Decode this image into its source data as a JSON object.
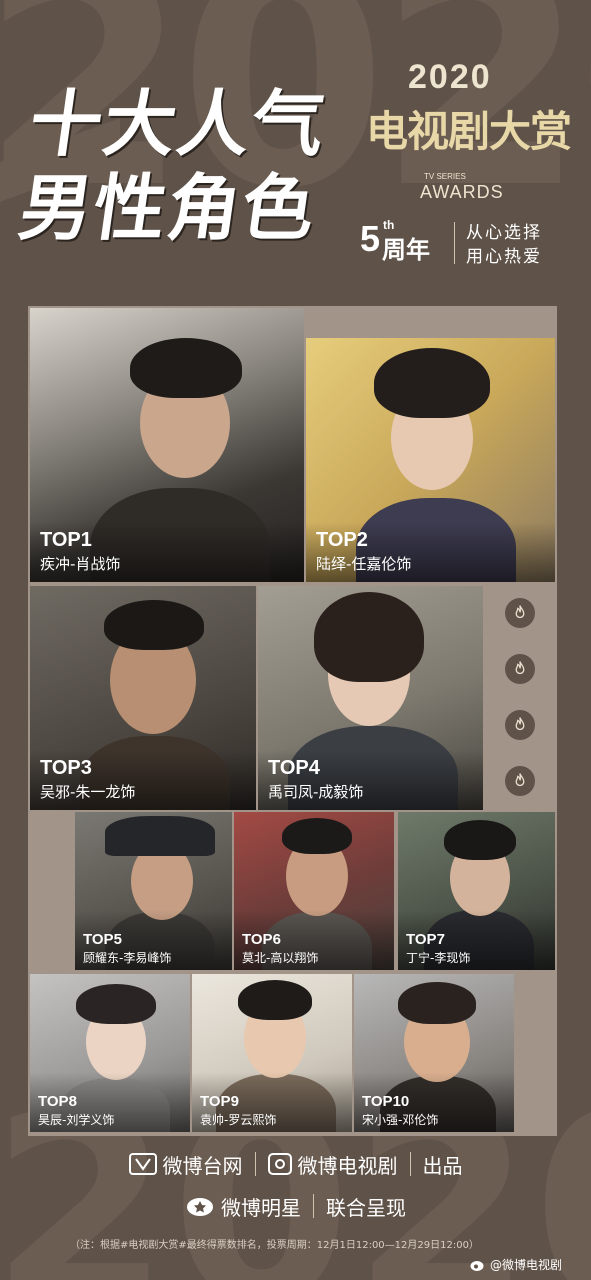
{
  "background": {
    "numerals": "2020"
  },
  "header": {
    "headline_line1": "十大人气",
    "headline_line2": "男性角色",
    "year": "2020",
    "award_name": "电视剧大赏",
    "tv_series": "TV SERIES",
    "awards": "AWARDS",
    "anniversary_number": "5",
    "anniversary_suffix": "th",
    "anniversary_word": "周年",
    "slogan_line1": "从心选择",
    "slogan_line2": "用心热爱"
  },
  "ranking": [
    {
      "rank": "TOP1",
      "role": "疾冲-肖战饰"
    },
    {
      "rank": "TOP2",
      "role": "陆绎-任嘉伦饰"
    },
    {
      "rank": "TOP3",
      "role": "吴邪-朱一龙饰"
    },
    {
      "rank": "TOP4",
      "role": "禹司凤-成毅饰"
    },
    {
      "rank": "TOP5",
      "role": "顾耀东-李易峰饰"
    },
    {
      "rank": "TOP6",
      "role": "莫北-高以翔饰"
    },
    {
      "rank": "TOP7",
      "role": "丁宁-李现饰"
    },
    {
      "rank": "TOP8",
      "role": "昊辰-刘学义饰"
    },
    {
      "rank": "TOP9",
      "role": "袁帅-罗云熙饰"
    },
    {
      "rank": "TOP10",
      "role": "宋小强-邓伦饰"
    }
  ],
  "decor": {
    "fire_icon_count": 4
  },
  "footer": {
    "logo1": "微博台网",
    "logo2": "微博电视剧",
    "produced": "出品",
    "logo3": "微博明星",
    "joint": "联合呈现",
    "note": "（注：根据#电视剧大赏#最终得票数排名，投票周期：12月1日12:00—12月29日12:00）",
    "watermark": "@微博电视剧"
  },
  "colors": {
    "background": "#5f5248",
    "frame": "#a3948a",
    "gold": "#e8d8a8",
    "text": "#ffffff"
  }
}
